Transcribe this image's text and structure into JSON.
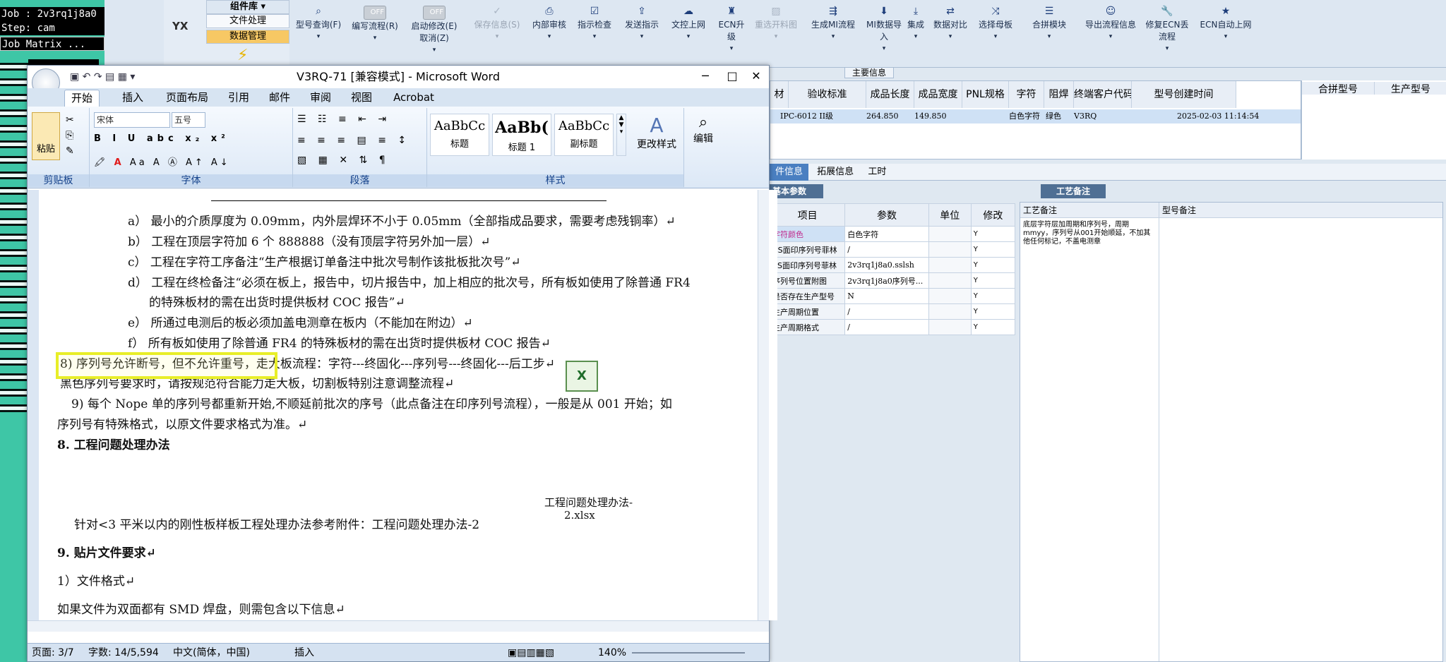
{
  "terminal": {
    "job": "Job : 2v3rq1j8a0",
    "step": "Step: cam",
    "matrix": "Job Matrix ..."
  },
  "erp_nav": {
    "menu_title": "组件库 ▾",
    "file_mgmt": "文件处理",
    "data_mgmt": "数据管理",
    "logo": "YX"
  },
  "toolbar": [
    {
      "icon": "search-icon",
      "label": "型号查询(F)",
      "disabled": false
    },
    {
      "icon": "toggle-off",
      "label": "编写流程(R)",
      "toggle": "OFF",
      "disabled": false
    },
    {
      "icon": "toggle-off",
      "label": "启动修改(E)",
      "sub": "取消(Z)",
      "toggle": "OFF",
      "disabled": false
    },
    {
      "icon": "check-icon",
      "label": "保存信息(S)",
      "disabled": true
    },
    {
      "icon": "print-icon",
      "label": "内部审核",
      "disabled": false
    },
    {
      "icon": "checkbox-icon",
      "label": "指示检查",
      "disabled": false
    },
    {
      "icon": "upload-icon",
      "label": "发送指示",
      "disabled": false
    },
    {
      "icon": "cloud-upload-icon",
      "label": "文控上网",
      "disabled": false
    },
    {
      "icon": "ecn-icon",
      "label": "ECN升级",
      "disabled": false
    },
    {
      "icon": "image-icon",
      "label": "重选开料图",
      "disabled": true
    },
    {
      "icon": "flow-icon",
      "label": "生成MI流程",
      "disabled": false
    },
    {
      "icon": "import-icon",
      "label": "MI数据导入",
      "disabled": false
    },
    {
      "icon": "download-icon",
      "label": "集成",
      "disabled": false
    },
    {
      "icon": "compare-icon",
      "label": "数据对比",
      "disabled": false
    },
    {
      "icon": "shuffle-icon",
      "label": "选择母板",
      "disabled": false
    },
    {
      "icon": "list-icon",
      "label": "合拼模块",
      "disabled": false
    },
    {
      "icon": "smile-icon",
      "label": "导出流程信息",
      "disabled": false
    },
    {
      "icon": "wrench-icon",
      "label": "修复ECN丢流程",
      "disabled": false
    },
    {
      "icon": "star-icon",
      "label": "ECN自动上网",
      "disabled": false
    }
  ],
  "main_info_tab": "主要信息",
  "top_grid": {
    "headers": [
      "材",
      "验收标准",
      "成品长度",
      "成品宽度",
      "PNL规格",
      "字符",
      "阻焊",
      "终端客户代码",
      "型号创建时间"
    ],
    "row": [
      "IPC-6012 II级",
      "264.850",
      "149.850",
      "",
      "白色字符",
      "绿色",
      "V3RQ",
      "2025-02-03 11:14:54"
    ],
    "side_headers": [
      "合拼型号",
      "生产型号"
    ]
  },
  "lower_tabs": [
    "件信息",
    "拓展信息",
    "工时"
  ],
  "basic_params": {
    "title": "基本参数",
    "headers": [
      "项目",
      "参数",
      "单位",
      "修改"
    ],
    "rows": [
      {
        "item": "字符颜色",
        "param": "白色字符",
        "unit": "",
        "mod": "Y"
      },
      {
        "item": "CS面印序列号菲林",
        "param": "/",
        "unit": "",
        "mod": "Y"
      },
      {
        "item": "SS面印序列号菲林",
        "param": "2v3rq1j8a0.sslsh",
        "unit": "",
        "mod": "Y"
      },
      {
        "item": "序列号位置附图",
        "param": "2v3rq1j8a0序列号...",
        "unit": "",
        "mod": "Y"
      },
      {
        "item": "是否存在生产型号",
        "param": "N",
        "unit": "",
        "mod": "Y"
      },
      {
        "item": "生产周期位置",
        "param": "/",
        "unit": "",
        "mod": "Y"
      },
      {
        "item": "生产周期格式",
        "param": "/",
        "unit": "",
        "mod": "Y"
      }
    ]
  },
  "process_notes": {
    "tab": "工艺备注",
    "col1": "工艺备注",
    "col2": "型号备注",
    "note": "底层字符层加周期和序列号，周期mmyy，序列号从001开始顺延，不加其他任何标记，不盖电测章"
  },
  "word": {
    "title": "V3RQ-71 [兼容模式] - Microsoft Word",
    "tabs": [
      "开始",
      "插入",
      "页面布局",
      "引用",
      "邮件",
      "审阅",
      "视图",
      "Acrobat"
    ],
    "font_name": "宋体",
    "font_size": "五号",
    "groups": [
      "剪贴板",
      "字体",
      "段落",
      "样式",
      "编辑"
    ],
    "paste": "粘贴",
    "styles": [
      {
        "preview": "AaBbCc",
        "name": "标题"
      },
      {
        "preview": "AaBb(",
        "name": "标题 1"
      },
      {
        "preview": "AaBbCc",
        "name": "副标题"
      }
    ],
    "change_styles": "更改样式",
    "edit": "编辑",
    "lines": {
      "a": "a） 最小的介质厚度为 0.09mm，内外层焊环不小于 0.05mm（全部指成品要求，需要考虑残铜率）↵",
      "b": "b） 工程在顶层字符加 6 个 888888（没有顶层字符另外加一层）↵",
      "c": "c） 工程在字符工序备注“生产根据订单备注中批次号制作该批板批次号”↵",
      "d1": "d） 工程在终检备注“必须在板上，报告中，切片报告中，加上相应的批次号，所有板如使用了除普通 FR4",
      "d2": "的特殊板材的需在出货时提供板材 COC 报告”↵",
      "e": "e） 所通过电测后的板必须加盖电测章在板内（不能加在附边）↵",
      "f": "f） 所有板如使用了除普通 FR4 的特殊板材的需在出货时提供板材 COC 报告↵",
      "s8": "8) 序列号允许断号，但不允许重号，走大板流程：字符---终固化---序列号---终固化---后工步↵",
      "s8b": "黑色序列号要求时，请按规范符合能力走大板，切割板特别注意调整流程↵",
      "s9a": "9) 每个 Nope 单的序列号都重新开始,不顺延前批次的序号（此点备注在印序列号流程），一般是从 001 开始；如",
      "s9b": "序列号有特殊格式，以原文件要求格式为准。↵",
      "h8": "8.  工程问题处理办法",
      "attach": "工程问题处理办法-",
      "attach2": "2.xlsx",
      "note": "针对<3 平米以内的刚性板样板工程处理办法参考附件：工程问题处理办法-2",
      "h9": "9. 贴片文件要求↵",
      "f1": "1）文件格式↵",
      "smd": "如果文件为双面都有 SMD 焊盘，则需包含以下信息↵"
    },
    "status": {
      "page": "页面: 3/7",
      "words": "字数: 14/5,594",
      "lang": "中文(简体，中国)",
      "mode": "插入",
      "zoom": "140%"
    }
  }
}
